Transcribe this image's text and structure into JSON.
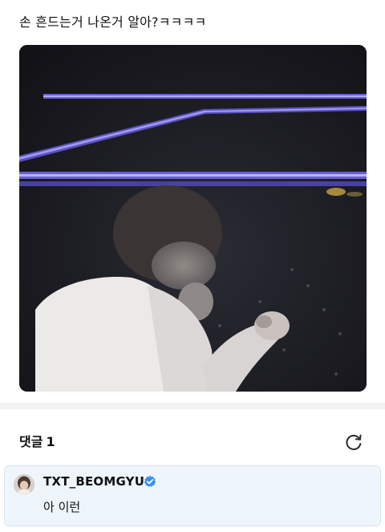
{
  "post": {
    "text": "손 흔드는거 나온거 알아?ㅋㅋㅋㅋ"
  },
  "comments": {
    "label": "댓글",
    "count": "1",
    "items": [
      {
        "author": "TXT_BEOMGYU",
        "verified": true,
        "text": "아 이런"
      }
    ]
  },
  "icons": {
    "refresh": "refresh-icon",
    "verified": "verified-badge-icon",
    "avatar": "avatar"
  },
  "colors": {
    "verified_blue": "#3b8ff0",
    "card_bg": "#eef5fb",
    "stage_light": "#6a5fd8"
  }
}
